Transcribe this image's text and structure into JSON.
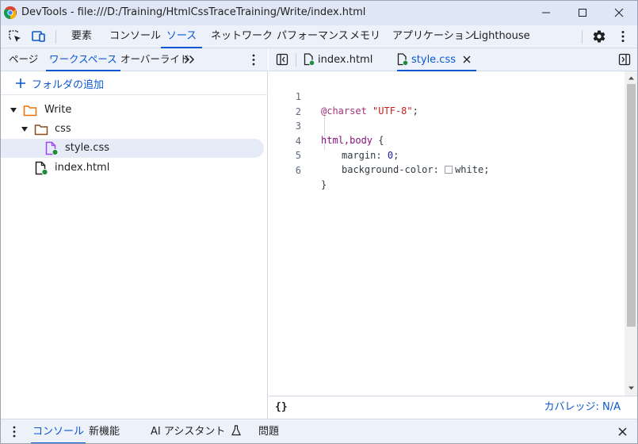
{
  "window": {
    "title": "DevTools - file:///D:/Training/HtmlCssTraceTraining/Write/index.html"
  },
  "main_tabs": [
    {
      "label": "要素",
      "active": false
    },
    {
      "label": "コンソール",
      "active": false
    },
    {
      "label": "ソース",
      "active": true
    },
    {
      "label": "ネットワーク",
      "active": false
    },
    {
      "label": "パフォーマンス",
      "active": false
    },
    {
      "label": "メモリ",
      "active": false
    },
    {
      "label": "アプリケーション",
      "active": false
    },
    {
      "label": "Lighthouse",
      "active": false
    }
  ],
  "sources_sub_tabs": [
    {
      "label": "ページ",
      "active": false
    },
    {
      "label": "ワークスペース",
      "active": true
    },
    {
      "label": "オーバーライド",
      "active": false
    }
  ],
  "workspace": {
    "add_folder_label": "フォルダの追加",
    "tree": [
      {
        "label": "Write",
        "kind": "folder"
      },
      {
        "label": "css",
        "kind": "folder"
      },
      {
        "label": "style.css",
        "kind": "css-file",
        "selected": true
      },
      {
        "label": "index.html",
        "kind": "html-file"
      }
    ]
  },
  "editor": {
    "tabs": [
      {
        "label": "index.html",
        "active": false
      },
      {
        "label": "style.css",
        "active": true
      }
    ],
    "line_numbers": [
      "1",
      "2",
      "3",
      "4",
      "5",
      "6"
    ],
    "code": {
      "charset_rule": "@charset",
      "charset_value": "\"UTF-8\"",
      "semicolon": ";",
      "selector": "html,body",
      "open_brace": "{",
      "close_brace": "}",
      "prop_margin": "margin",
      "val_margin": "0",
      "prop_bg": "background-color",
      "val_bg": "white",
      "colon": ":"
    }
  },
  "status": {
    "pretty_print": "{}",
    "coverage": "カバレッジ: N/A"
  },
  "drawer_tabs": [
    {
      "label": "コンソール",
      "active": true
    },
    {
      "label": "新機能",
      "active": false
    },
    {
      "label": "AI アシスタント",
      "active": false
    },
    {
      "label": "問題",
      "active": false
    }
  ],
  "colors": {
    "accent": "#0b57d0",
    "folder": "#e8710a",
    "css_file": "#a142f4",
    "status_dot": "#1e8e3e"
  },
  "icons": [
    "chrome-logo-icon",
    "inspect-element-icon",
    "device-toolbar-icon",
    "gear-icon",
    "more-vert-icon",
    "chevron-double-right-icon",
    "plus-icon",
    "folder-icon",
    "file-icon",
    "toggle-sidebar-icon",
    "close-icon",
    "flask-icon"
  ]
}
